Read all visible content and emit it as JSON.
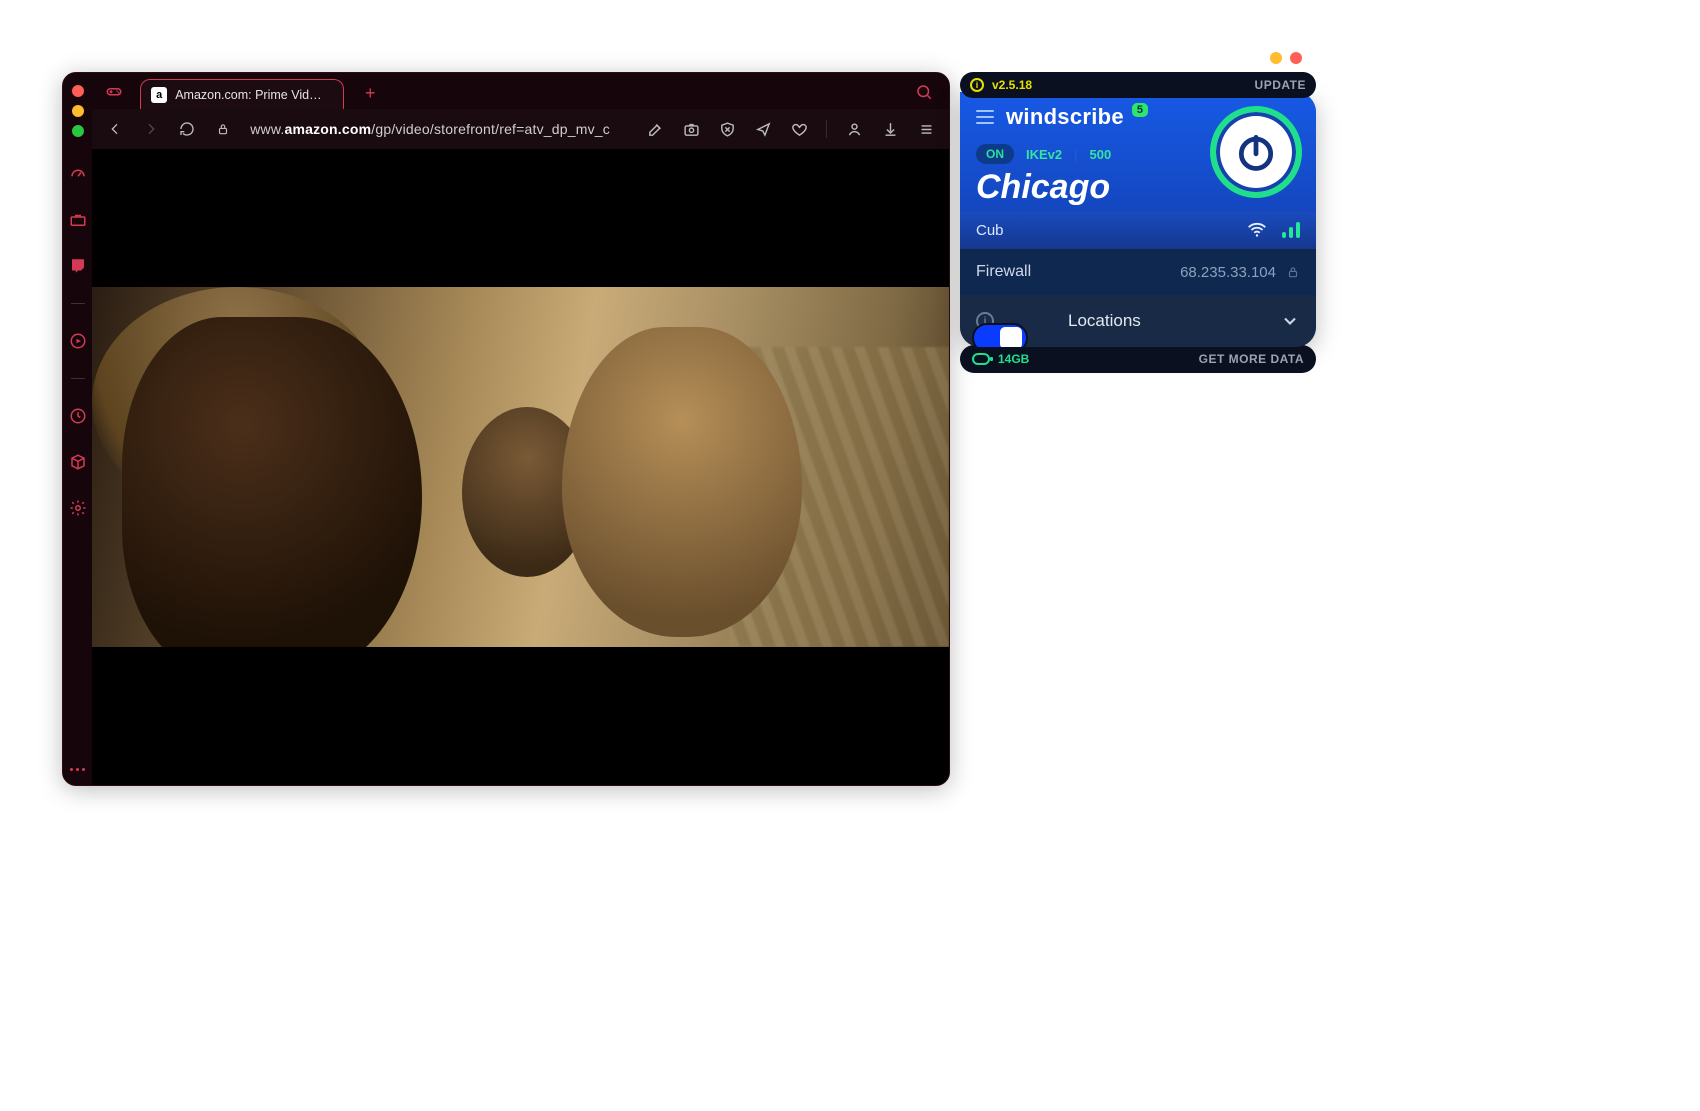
{
  "browser": {
    "tab": {
      "favicon_letter": "a",
      "title": "Amazon.com: Prime Video: Prime"
    },
    "url_display_prefix": "www.",
    "url_display_host": "amazon.com",
    "url_display_path": "/gp/video/storefront/ref=atv_dp_mv_c"
  },
  "windscribe": {
    "version": "v2.5.18",
    "update_label": "UPDATE",
    "brand": "windscribe",
    "notif_badge": "5",
    "status": {
      "on": "ON",
      "protocol": "IKEv2",
      "port": "500"
    },
    "location": "Chicago",
    "sublocation": "Cub",
    "firewall_label": "Firewall",
    "ip": "68.235.33.104",
    "locations_label": "Locations",
    "data_remaining": "14GB",
    "get_more": "GET MORE DATA"
  }
}
